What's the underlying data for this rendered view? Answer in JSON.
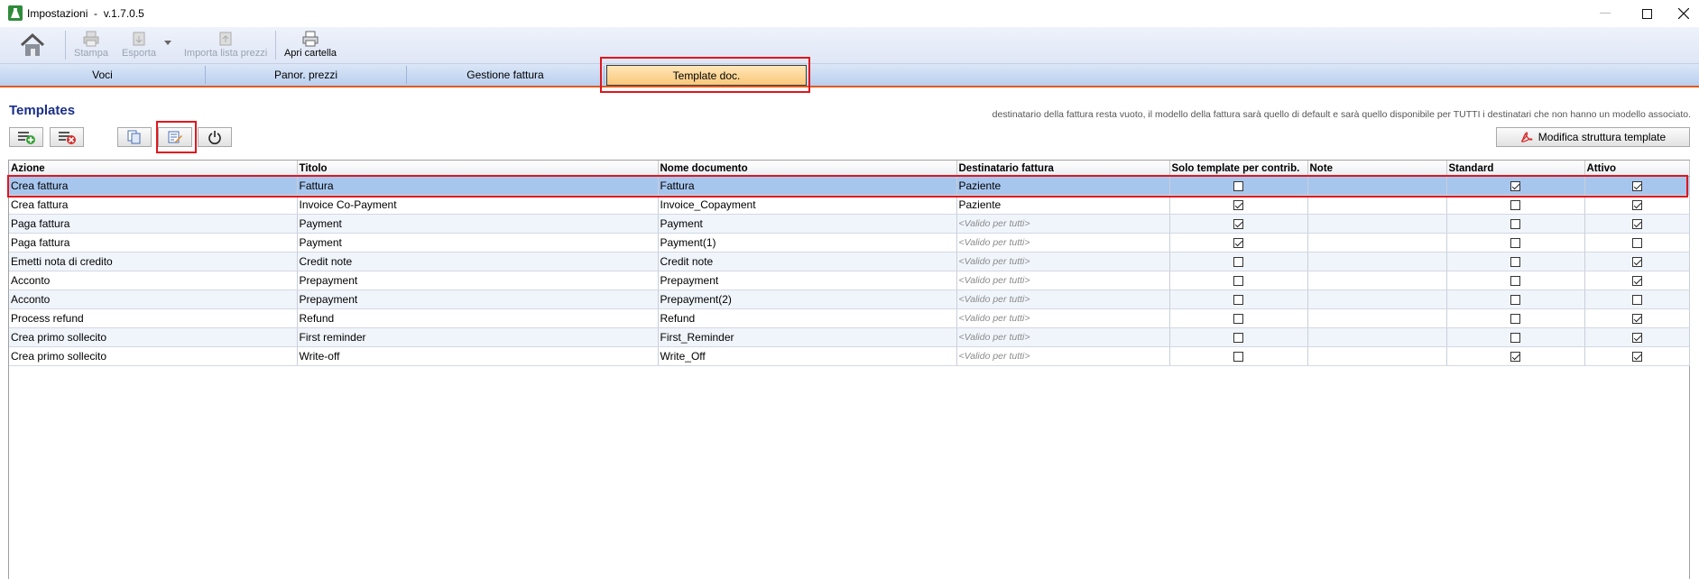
{
  "window": {
    "title": "Impostazioni  -  v.1.7.0.5"
  },
  "toolbar": {
    "buttons": [
      {
        "label": "",
        "icon": "home-icon"
      },
      {
        "label": "Stampa",
        "icon": "printer-icon",
        "disabled": true
      },
      {
        "label": "Esporta",
        "icon": "export-icon",
        "disabled": true
      },
      {
        "label": "Importa lista prezzi",
        "icon": "import-icon",
        "disabled": true
      },
      {
        "label": "Apri cartella",
        "icon": "folder-printer-icon",
        "disabled": false
      }
    ]
  },
  "tabs": [
    {
      "label": "Voci",
      "active": false
    },
    {
      "label": "Panor. prezzi",
      "active": false
    },
    {
      "label": "Gestione fattura",
      "active": false
    },
    {
      "label": "Template doc.",
      "active": true
    }
  ],
  "section": {
    "title": "Templates",
    "info": "destinatario della fattura resta vuoto, il modello della fattura sarà quello di default e sarà quello disponibile per TUTTI i destinatari che non hanno un modello associato.",
    "modify_button": "Modifica struttura template"
  },
  "table": {
    "columns": [
      "Azione",
      "Titolo",
      "Nome documento",
      "Destinatario fattura",
      "Solo template per contrib.",
      "Note",
      "Standard",
      "Attivo"
    ],
    "rows": [
      {
        "azione": "Crea fattura",
        "titolo": "Fattura",
        "nome": "Fattura",
        "destinatario": "Paziente",
        "dest_placeholder": false,
        "solo": false,
        "note": "",
        "standard": true,
        "attivo": true,
        "selected": true
      },
      {
        "azione": "Crea fattura",
        "titolo": "Invoice Co-Payment",
        "nome": "Invoice_Copayment",
        "destinatario": "Paziente",
        "dest_placeholder": false,
        "solo": true,
        "note": "",
        "standard": false,
        "attivo": true
      },
      {
        "azione": "Paga fattura",
        "titolo": "Payment",
        "nome": "Payment",
        "destinatario": "<Valido per tutti>",
        "dest_placeholder": true,
        "solo": true,
        "note": "",
        "standard": false,
        "attivo": true
      },
      {
        "azione": "Paga fattura",
        "titolo": "Payment",
        "nome": "Payment(1)",
        "destinatario": "<Valido per tutti>",
        "dest_placeholder": true,
        "solo": true,
        "note": "",
        "standard": false,
        "attivo": false
      },
      {
        "azione": "Emetti nota di credito",
        "titolo": "Credit note",
        "nome": "Credit note",
        "destinatario": "<Valido per tutti>",
        "dest_placeholder": true,
        "solo": false,
        "note": "",
        "standard": false,
        "attivo": true
      },
      {
        "azione": "Acconto",
        "titolo": "Prepayment",
        "nome": "Prepayment",
        "destinatario": "<Valido per tutti>",
        "dest_placeholder": true,
        "solo": false,
        "note": "",
        "standard": false,
        "attivo": true
      },
      {
        "azione": "Acconto",
        "titolo": "Prepayment",
        "nome": "Prepayment(2)",
        "destinatario": "<Valido per tutti>",
        "dest_placeholder": true,
        "solo": false,
        "note": "",
        "standard": false,
        "attivo": false
      },
      {
        "azione": "Process refund",
        "titolo": "Refund",
        "nome": "Refund",
        "destinatario": "<Valido per tutti>",
        "dest_placeholder": true,
        "solo": false,
        "note": "",
        "standard": false,
        "attivo": true
      },
      {
        "azione": "Crea primo sollecito",
        "titolo": "First reminder",
        "nome": "First_Reminder",
        "destinatario": "<Valido per tutti>",
        "dest_placeholder": true,
        "solo": false,
        "note": "",
        "standard": false,
        "attivo": true
      },
      {
        "azione": "Crea primo sollecito",
        "titolo": "Write-off",
        "nome": "Write_Off",
        "destinatario": "<Valido per tutti>",
        "dest_placeholder": true,
        "solo": false,
        "note": "",
        "standard": true,
        "attivo": true
      }
    ]
  },
  "colors": {
    "accent_tab": "#f9c77a",
    "selected_row": "#a7c6ee",
    "highlight_box": "#e0161e",
    "section_title": "#1a2f8a"
  }
}
